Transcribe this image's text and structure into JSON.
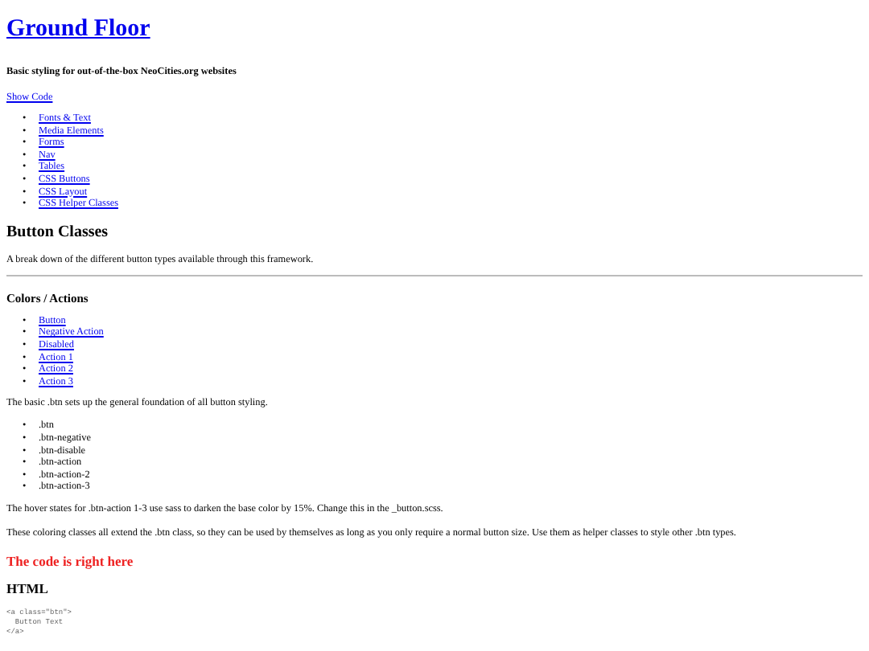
{
  "title": "Ground Floor",
  "subtitle": "Basic styling for out-of-the-box NeoCities.org websites",
  "show_code_link": "Show Code",
  "nav_links": [
    {
      "bullet": "•",
      "label": "Fonts & Text"
    },
    {
      "bullet": "•",
      "label": "Media Elements"
    },
    {
      "bullet": "•",
      "label": "Forms"
    },
    {
      "bullet": "•",
      "label": "Nav"
    },
    {
      "bullet": "•",
      "label": "Tables"
    },
    {
      "bullet": "•",
      "label": "CSS Buttons"
    },
    {
      "bullet": "•",
      "label": "CSS Layout"
    },
    {
      "bullet": "•",
      "label": "CSS Helper Classes"
    }
  ],
  "section_heading": "Button Classes",
  "section_intro": "A break down of the different button types available through this framework.",
  "subheading": "Colors / Actions",
  "button_links": [
    {
      "bullet": "•",
      "label": "Button"
    },
    {
      "bullet": "•",
      "label": "Negative Action"
    },
    {
      "bullet": "•",
      "label": "Disabled"
    },
    {
      "bullet": "•",
      "label": "Action 1"
    },
    {
      "bullet": "•",
      "label": "Action 2"
    },
    {
      "bullet": "•",
      "label": "Action 3"
    }
  ],
  "basic_paragraph": "The basic .btn sets up the general foundation of all button styling.",
  "class_list": [
    {
      "bullet": "•",
      "label": ".btn"
    },
    {
      "bullet": "•",
      "label": ".btn-negative"
    },
    {
      "bullet": "•",
      "label": ".btn-disable"
    },
    {
      "bullet": "•",
      "label": ".btn-action"
    },
    {
      "bullet": "•",
      "label": ".btn-action-2"
    },
    {
      "bullet": "•",
      "label": ".btn-action-3"
    }
  ],
  "hover_paragraph": "The hover states for .btn-action 1-3 use sass to darken the base color by 15%. Change this in the _button.scss.",
  "coloring_paragraph": "These coloring classes all extend the .btn class, so they can be used by themselves as long as you only require a normal button size. Use them as helper classes to style other .btn types.",
  "code_heading": "The code is right here",
  "html_heading": "HTML",
  "code_lines": [
    "<a class=\"btn\">",
    "  Button Text",
    "</a>"
  ]
}
